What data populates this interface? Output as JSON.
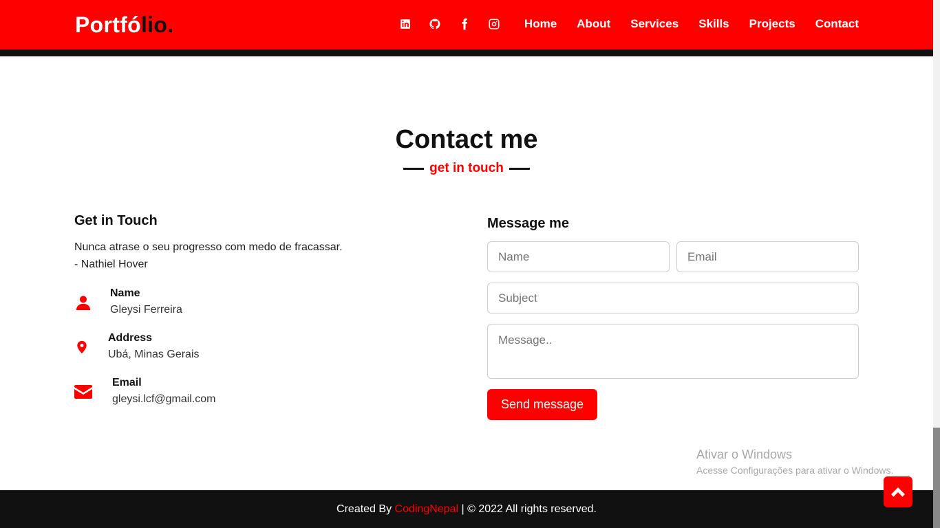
{
  "brand": {
    "logo_main": "Portfó",
    "logo_accent": "lio."
  },
  "nav": {
    "social_icons": [
      "linkedin-icon",
      "github-icon",
      "facebook-icon",
      "instagram-icon"
    ],
    "links": [
      "Home",
      "About",
      "Services",
      "Skills",
      "Projects",
      "Contact"
    ]
  },
  "section": {
    "title": "Contact me",
    "subtitle": "get in touch"
  },
  "left": {
    "title": "Get in Touch",
    "quote_line1": "Nunca atrase o seu progresso com medo de fracassar.",
    "quote_line2": "- Nathiel Hover",
    "items": [
      {
        "head": "Name",
        "value": "Gleysi Ferreira",
        "icon": "user-icon"
      },
      {
        "head": "Address",
        "value": "Ubá, Minas Gerais",
        "icon": "map-marker-icon"
      },
      {
        "head": "Email",
        "value": "gleysi.lcf@gmail.com",
        "icon": "envelope-icon"
      }
    ]
  },
  "form": {
    "title": "Message me",
    "name_placeholder": "Name",
    "email_placeholder": "Email",
    "subject_placeholder": "Subject",
    "message_placeholder": "Message..",
    "send_label": "Send message"
  },
  "watermark": {
    "title": "Ativar o Windows",
    "subtitle": "Acesse Configurações para ativar o Windows."
  },
  "footer": {
    "prefix": "Created By ",
    "brand": "CodingNepal",
    "suffix": " | © 2022 All rights reserved."
  },
  "colors": {
    "accent": "#ff0000",
    "dark": "#111111"
  }
}
